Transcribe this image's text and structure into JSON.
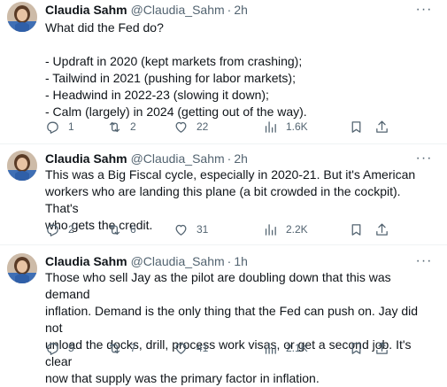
{
  "tweets": [
    {
      "name": "Claudia Sahm",
      "handle": "@Claudia_Sahm",
      "separator": "·",
      "time": "2h",
      "more_label": "···",
      "lines": [
        "What did the Fed do?",
        "",
        "- Updraft in 2020 (kept markets from crashing);",
        "- Tailwind in 2021 (pushing for labor markets);",
        "- Headwind in 2022-23 (slowing it down);",
        "- Calm (largely) in 2024 (getting out of the way)."
      ],
      "replies": "1",
      "reposts": "2",
      "likes": "22",
      "views": "1.6K"
    },
    {
      "name": "Claudia Sahm",
      "handle": "@Claudia_Sahm",
      "separator": "·",
      "time": "2h",
      "more_label": "···",
      "lines": [
        "This was a Big Fiscal cycle, especially in 2020-21. But it's American",
        "workers who are landing this plane (a bit crowded in the cockpit). That's",
        "who gets the credit."
      ],
      "replies": "2",
      "reposts": "6",
      "likes": "31",
      "views": "2.2K"
    },
    {
      "name": "Claudia Sahm",
      "handle": "@Claudia_Sahm",
      "separator": "·",
      "time": "1h",
      "more_label": "···",
      "lines": [
        "Those who sell Jay as the pilot are doubling down that this was demand",
        "inflation. Demand is the only thing that the Fed can push on. Jay did not",
        "unload the docks, drill, process work visas, or get a second job. It's clear",
        "now that supply was the primary factor in inflation."
      ],
      "replies": "5",
      "reposts": "7",
      "likes": "41",
      "views": "2.1K"
    }
  ],
  "icons": {
    "reply": "reply-icon",
    "repost": "repost-icon",
    "like": "heart-icon",
    "views": "views-icon",
    "bookmark": "bookmark-icon",
    "share": "share-icon"
  },
  "colors": {
    "text": "#0f1419",
    "secondary": "#536471",
    "divider": "#eff3f4"
  }
}
